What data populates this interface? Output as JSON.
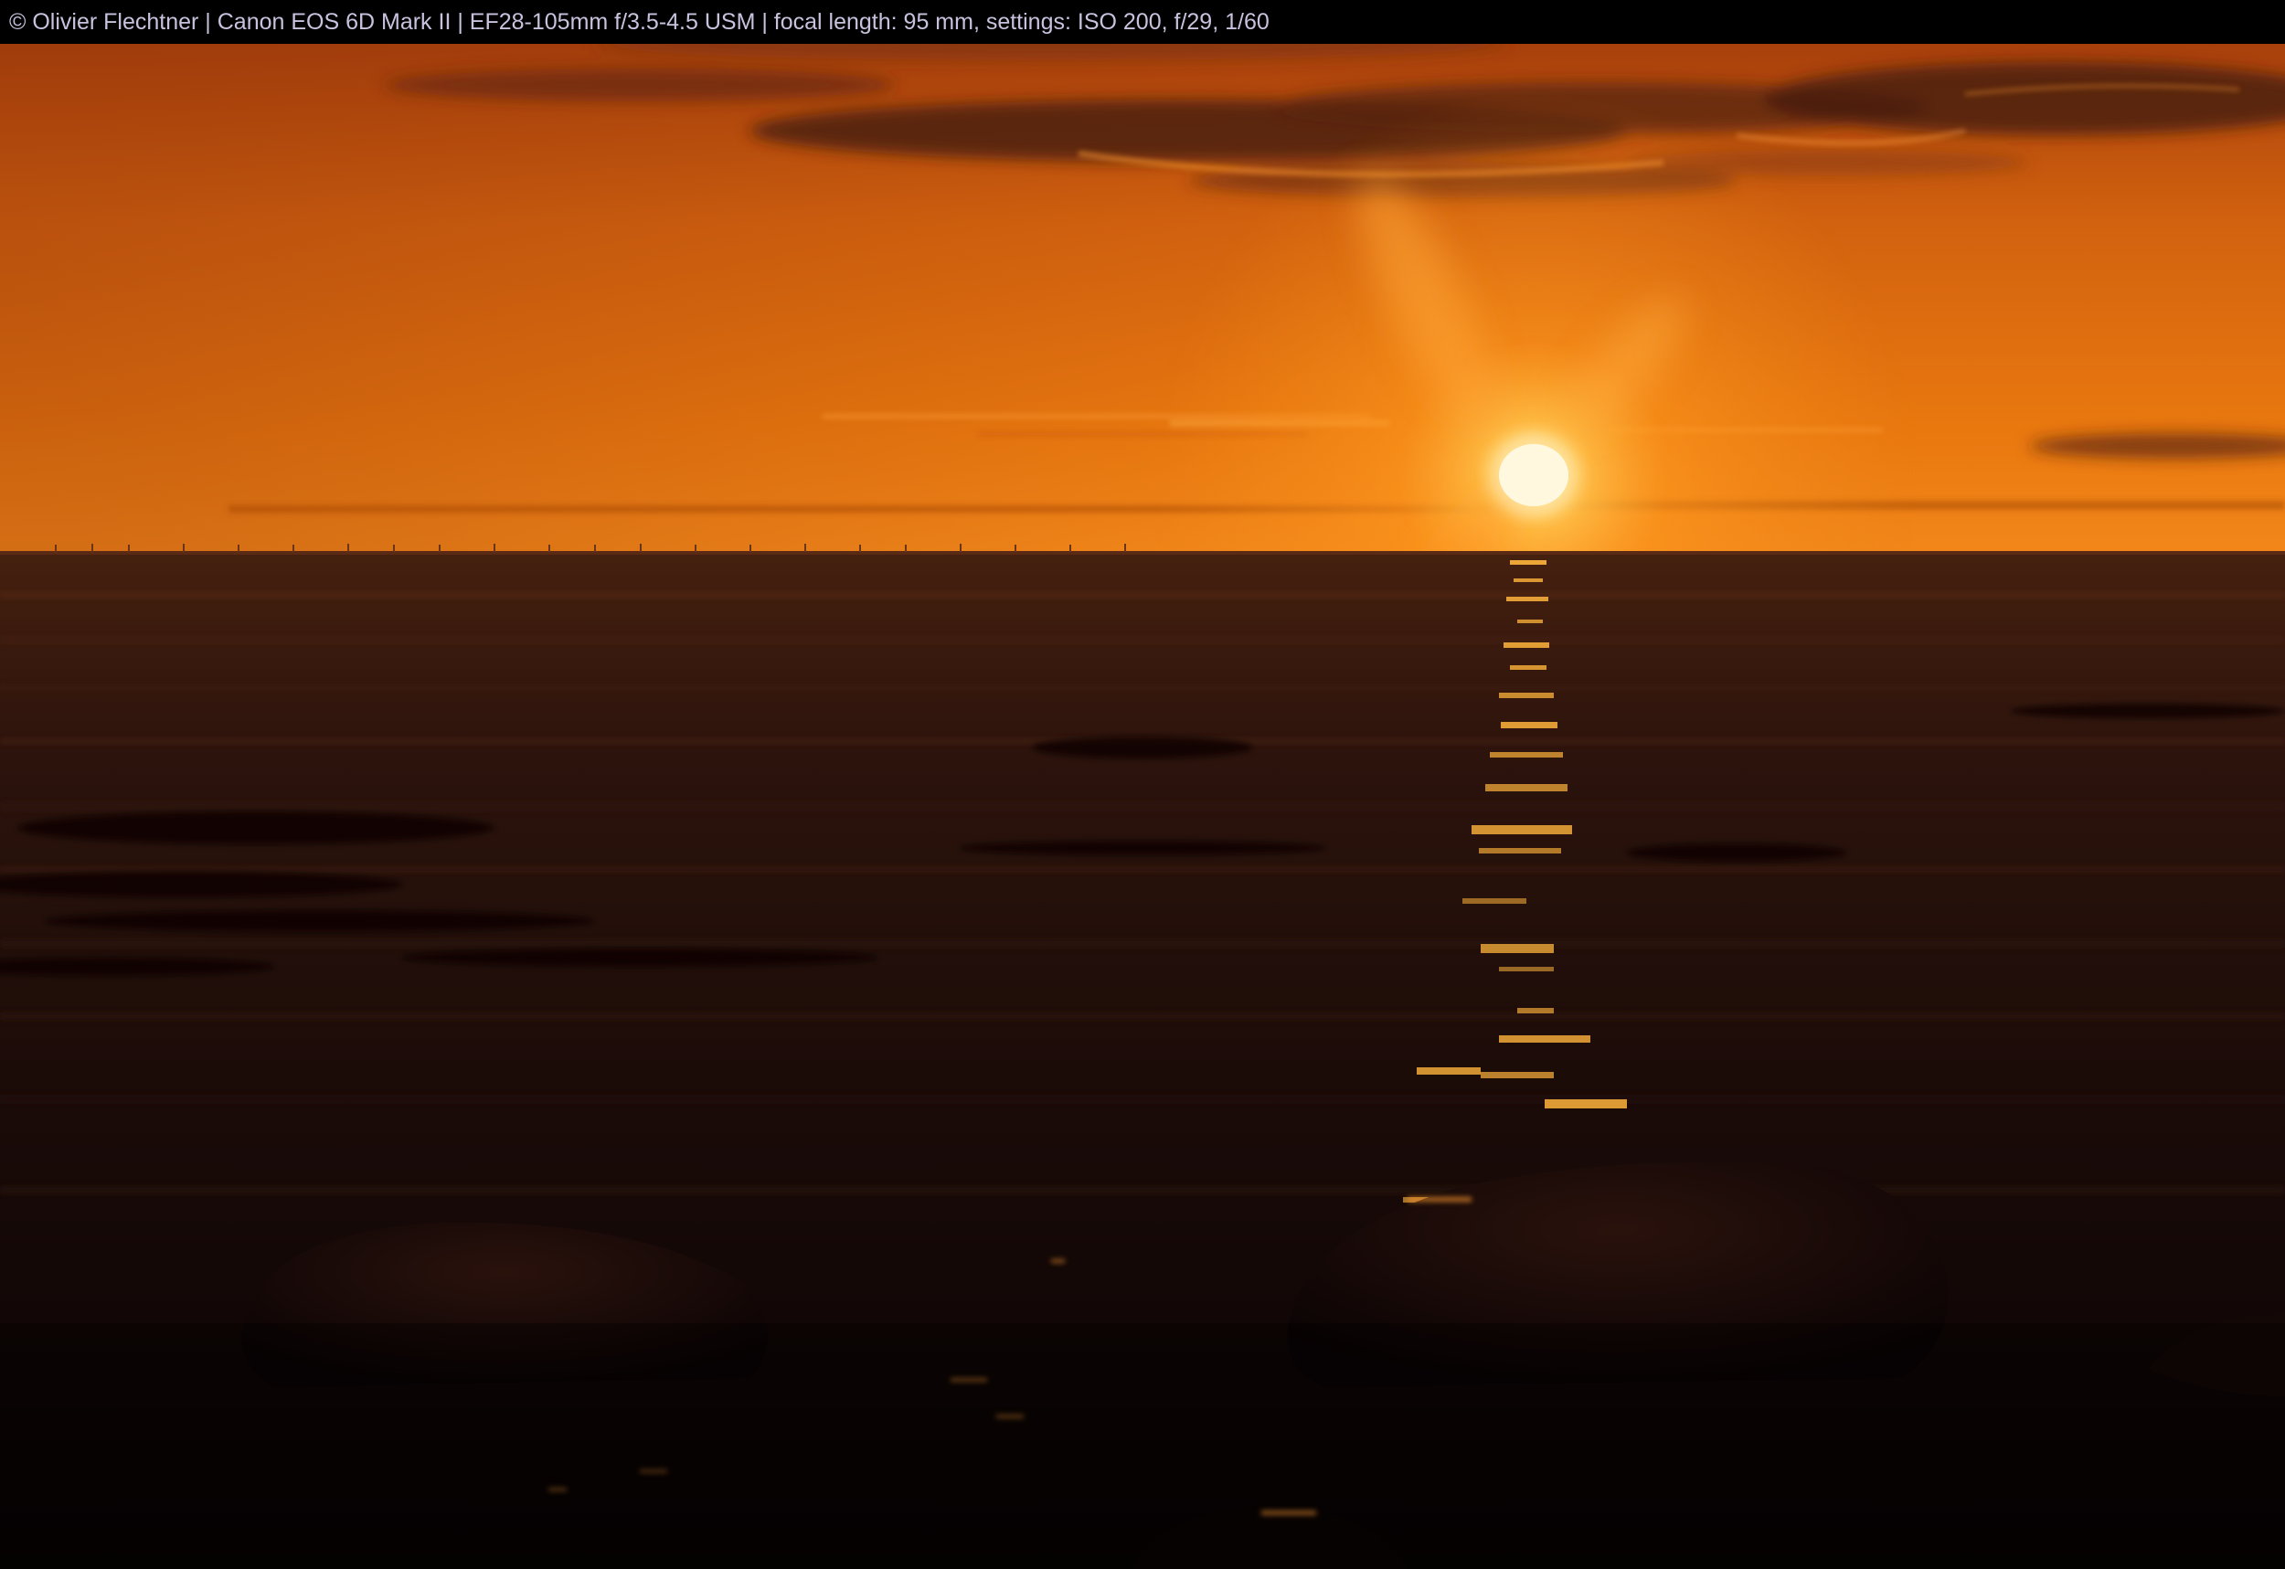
{
  "caption": {
    "text": "© Olivier Flechtner | Canon EOS 6D Mark II | EF28-105mm f/3.5-4.5 USM | focal length: 95 mm, settings: ISO 200, f/29, 1/60"
  },
  "photo": {
    "subject": "sunset-over-sea",
    "colors": {
      "sky_top": "#b8480c",
      "sky_mid": "#e3720f",
      "sky_horizon": "#f08a1a",
      "sun_core": "#ffffff",
      "sun_glow": "#ffb23a",
      "sea_near": "#0b0406",
      "sea_far": "#3a1a10",
      "cloud": "#4a1f12",
      "glitter": "#ffb43c"
    }
  }
}
